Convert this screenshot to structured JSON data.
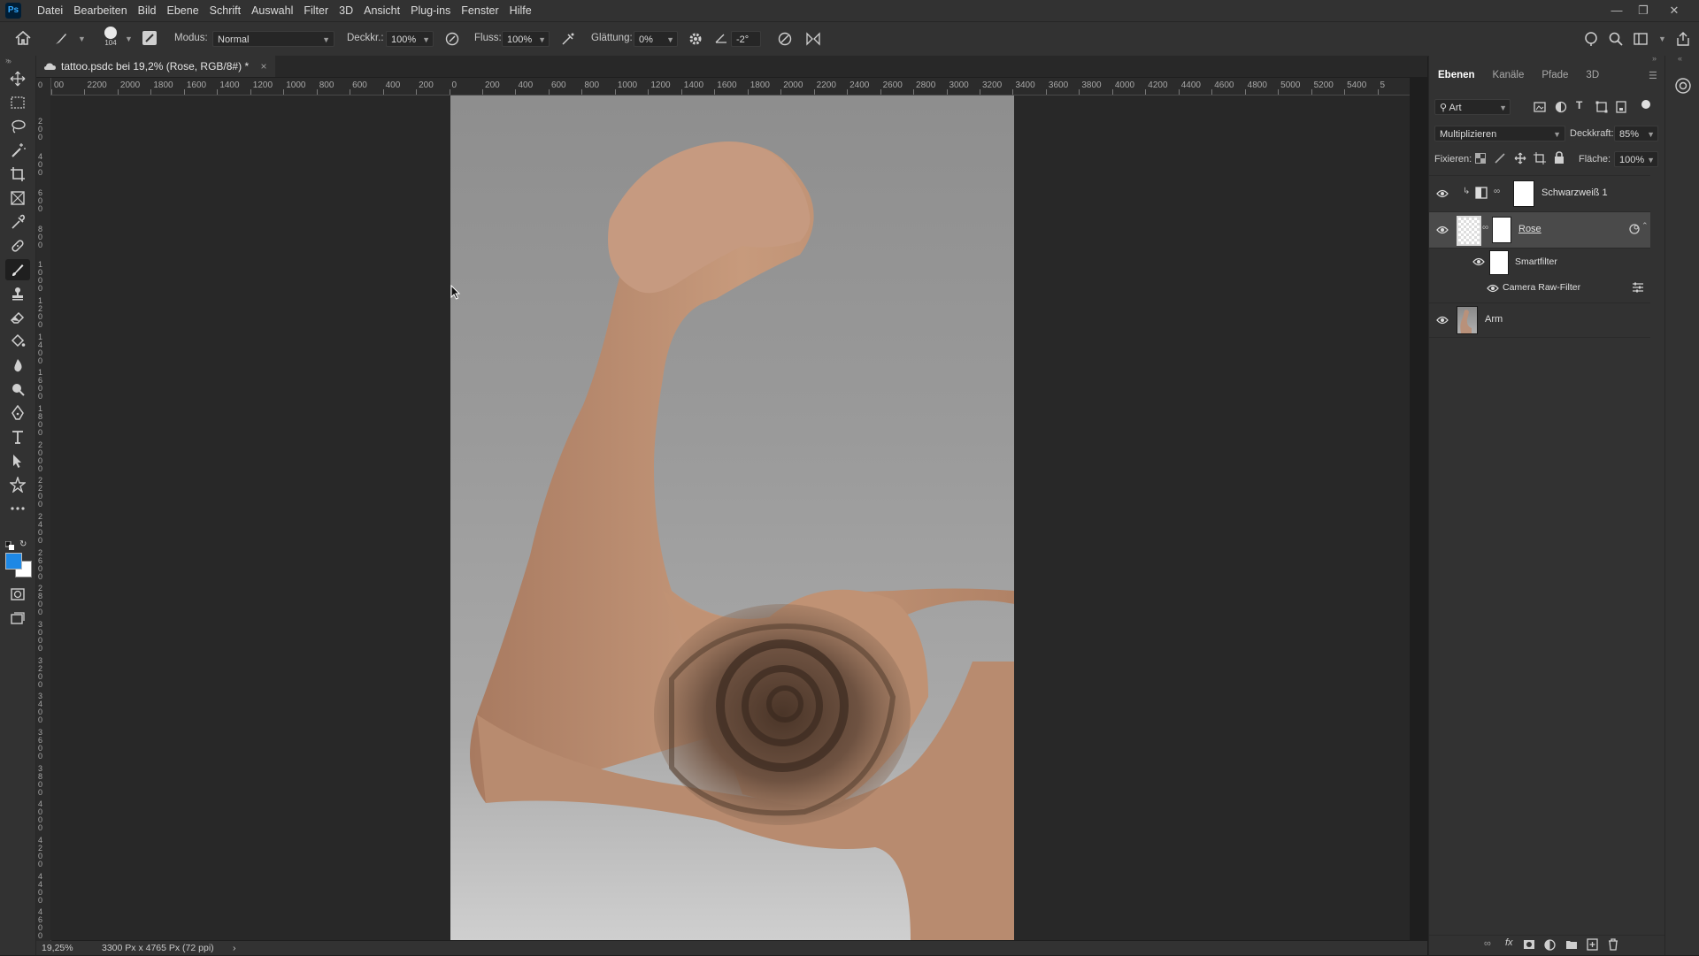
{
  "app": {
    "logo_text": "Ps"
  },
  "menu": [
    "Datei",
    "Bearbeiten",
    "Bild",
    "Ebene",
    "Schrift",
    "Auswahl",
    "Filter",
    "3D",
    "Ansicht",
    "Plug-ins",
    "Fenster",
    "Hilfe"
  ],
  "options": {
    "brush_size": "104",
    "mode_label": "Modus:",
    "mode_value": "Normal",
    "opacity_label": "Deckkr.:",
    "opacity_value": "100%",
    "flow_label": "Fluss:",
    "flow_value": "100%",
    "smoothing_label": "Glättung:",
    "smoothing_value": "0%",
    "angle_value": "-2°"
  },
  "document": {
    "tab_title": "tattoo.psdc bei 19,2% (Rose, RGB/8#) *",
    "close": "×"
  },
  "rulers": {
    "top": [
      "00",
      "2200",
      "2000",
      "1800",
      "1600",
      "1400",
      "1200",
      "1000",
      "800",
      "600",
      "400",
      "200",
      "0",
      "200",
      "400",
      "600",
      "800",
      "1000",
      "1200",
      "1400",
      "1600",
      "1800",
      "2000",
      "2200",
      "2400",
      "2600",
      "2800",
      "3000",
      "3200",
      "3400",
      "3600",
      "3800",
      "4000",
      "4200",
      "4400",
      "4600",
      "4800",
      "5000",
      "5200",
      "5400",
      "5"
    ],
    "left": [
      "0",
      "2 0 0",
      "4 0 0",
      "6 0 0",
      "8 0 0",
      "1 0 0 0",
      "1 2 0 0",
      "1 4 0 0",
      "1 6 0 0",
      "1 8 0 0",
      "2 0 0 0",
      "2 2 0 0",
      "2 4 0 0",
      "2 6 0 0",
      "2 8 0 0",
      "3 0 0 0",
      "3 2 0 0",
      "3 4 0 0",
      "3 6 0 0",
      "3 8 0 0",
      "4 0 0 0",
      "4 2 0 0",
      "4 4 0 0",
      "4 6 0 0"
    ]
  },
  "status": {
    "zoom": "19,25%",
    "doc_info": "3300 Px x 4765 Px (72 ppi)",
    "arrow": "›"
  },
  "panel": {
    "tabs": [
      "Ebenen",
      "Kanäle",
      "Pfade",
      "3D"
    ],
    "filter_kind": "Art",
    "blend_mode": "Multiplizieren",
    "opacity_label": "Deckkraft:",
    "opacity_value": "85%",
    "lock_label": "Fixieren:",
    "fill_label": "Fläche:",
    "fill_value": "100%",
    "layers": [
      {
        "name": "Schwarzweiß 1"
      },
      {
        "name": "Rose"
      },
      {
        "name": "Smartfilter"
      },
      {
        "name": "Camera Raw-Filter"
      },
      {
        "name": "Arm"
      }
    ]
  },
  "colors": {
    "foreground": "#1e88e5",
    "background": "#ffffff",
    "accent": "#31a8ff"
  }
}
